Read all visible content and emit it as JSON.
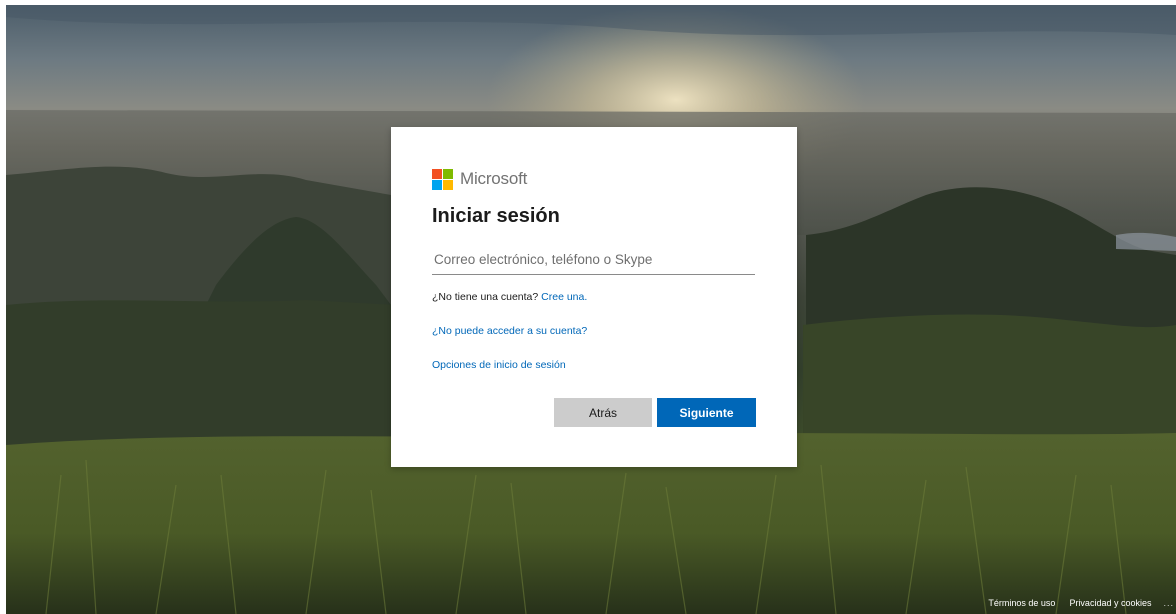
{
  "background": {
    "description_icon": "landscape-photo"
  },
  "brand": {
    "name": "Microsoft",
    "logo_colors": [
      "#f25022",
      "#7fba00",
      "#00a4ef",
      "#ffb900"
    ]
  },
  "signin": {
    "title": "Iniciar sesión",
    "email_placeholder": "Correo electrónico, teléfono o Skype",
    "email_value": "",
    "no_account_text": "¿No tiene una cuenta?",
    "create_link": "Cree una.",
    "cant_access_link": "¿No puede acceder a su cuenta?",
    "options_link": "Opciones de inicio de sesión",
    "back_label": "Atrás",
    "next_label": "Siguiente"
  },
  "footer": {
    "terms": "Términos de uso",
    "privacy": "Privacidad y cookies",
    "more": "..."
  },
  "colors": {
    "accent": "#0067b8",
    "secondary_button": "#cccccc"
  }
}
